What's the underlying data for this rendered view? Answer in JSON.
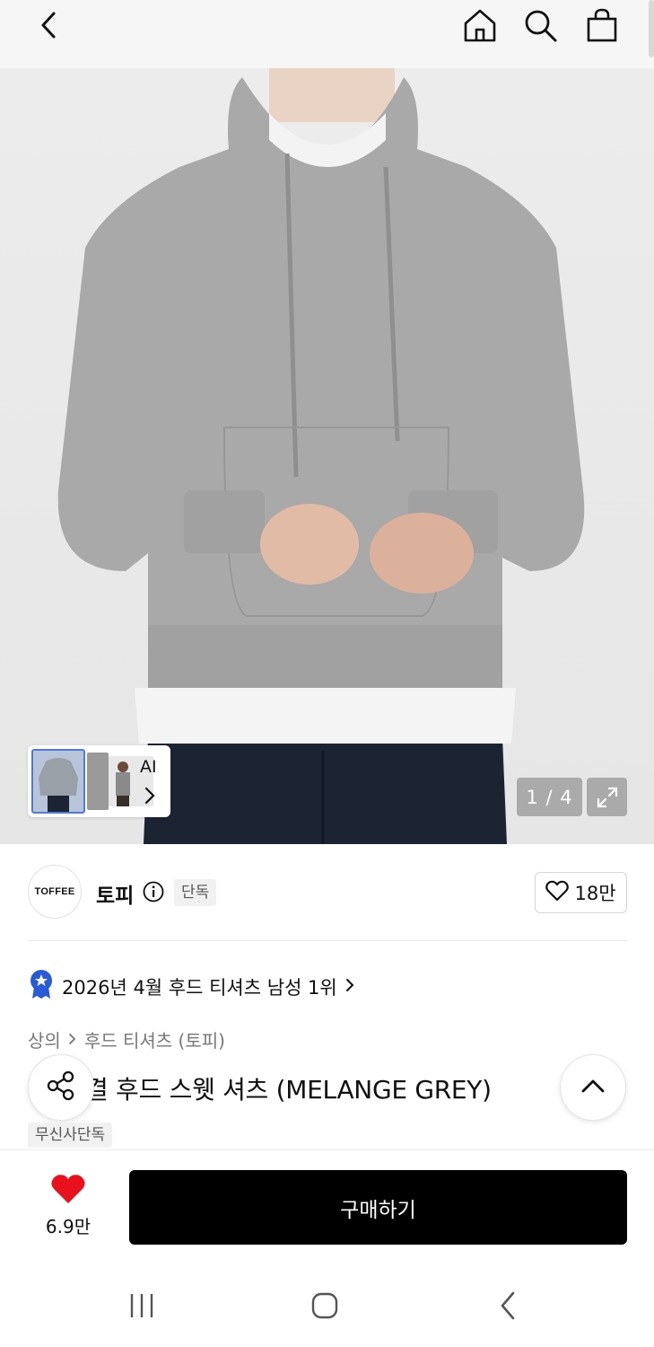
{
  "header": {
    "icons": [
      "back-icon",
      "home-icon",
      "search-icon",
      "cart-icon"
    ]
  },
  "gallery": {
    "ai_label": "AI",
    "page_indicator": "1 / 4",
    "icons": [
      "chevron-right-icon",
      "expand-icon"
    ]
  },
  "brand": {
    "logo_text": "TOFFEE",
    "name": "토피",
    "badge": "단독",
    "like_count": "18만",
    "icons": [
      "info-icon",
      "heart-outline-icon"
    ]
  },
  "ranking": {
    "text": "2026년 4월 후드 티셔츠 남성 1위",
    "icons": [
      "ranking-medal-icon",
      "chevron-right-icon"
    ]
  },
  "breadcrumb": {
    "items": [
      "상의",
      "후드 티셔츠 (토피)"
    ]
  },
  "product": {
    "title": "결 후드 스웻 셔츠 (MELANGE GREY)",
    "badge": "무신사단독"
  },
  "bottom_bar": {
    "wish_count": "6.9만",
    "buy_label": "구매하기",
    "heart_color": "#e8111d"
  },
  "system_nav": {
    "icons": [
      "recent-apps-icon",
      "home-circle-icon",
      "back-chevron-icon"
    ]
  },
  "colors": {
    "buy_button": "#000000",
    "rank_medal": "#2a5bd7"
  }
}
